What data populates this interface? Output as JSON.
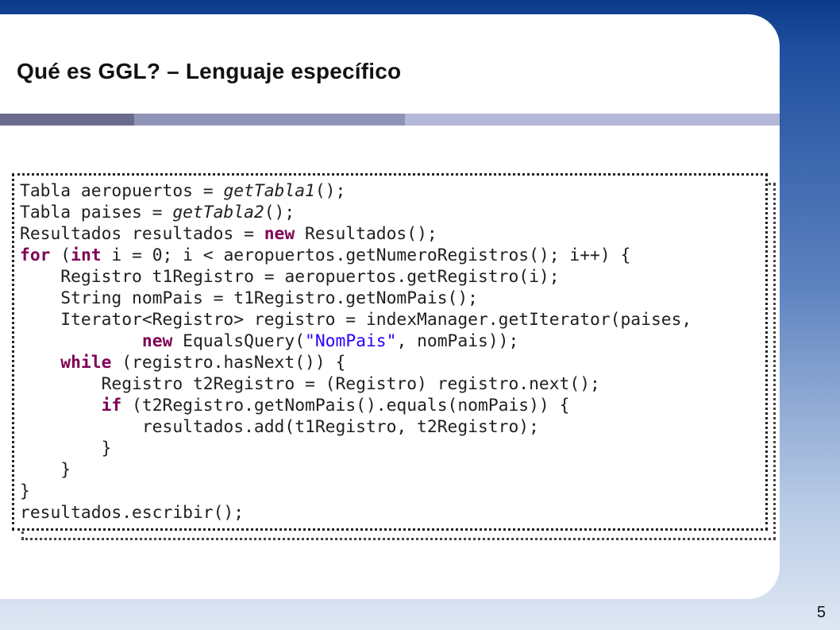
{
  "slide": {
    "title": "Qué es GGL? – Lenguaje específico",
    "page_number": "5"
  },
  "code": [
    [
      {
        "t": "Tabla aeropuertos = "
      },
      {
        "t": "getTabla1",
        "c": "it"
      },
      {
        "t": "();"
      }
    ],
    [
      {
        "t": "Tabla paises = "
      },
      {
        "t": "getTabla2",
        "c": "it"
      },
      {
        "t": "();"
      }
    ],
    [
      {
        "t": "Resultados resultados = "
      },
      {
        "t": "new",
        "c": "kw"
      },
      {
        "t": " Resultados();"
      }
    ],
    [
      {
        "t": "for",
        "c": "kw"
      },
      {
        "t": " ("
      },
      {
        "t": "int",
        "c": "kw"
      },
      {
        "t": " i = 0; i < aeropuertos.getNumeroRegistros(); i++) {"
      }
    ],
    [
      {
        "t": "    Registro t1Registro = aeropuertos.getRegistro(i);"
      }
    ],
    [
      {
        "t": "    String nomPais = t1Registro.getNomPais();"
      }
    ],
    [
      {
        "t": "    Iterator<Registro> registro = indexManager.getIterator(paises,"
      }
    ],
    [
      {
        "t": "            "
      },
      {
        "t": "new",
        "c": "kw"
      },
      {
        "t": " EqualsQuery("
      },
      {
        "t": "\"NomPais\"",
        "c": "str"
      },
      {
        "t": ", nomPais));"
      }
    ],
    [
      {
        "t": "    "
      },
      {
        "t": "while",
        "c": "kw"
      },
      {
        "t": " (registro.hasNext()) {"
      }
    ],
    [
      {
        "t": "        Registro t2Registro = (Registro) registro.next();"
      }
    ],
    [
      {
        "t": "        "
      },
      {
        "t": "if",
        "c": "kw"
      },
      {
        "t": " (t2Registro.getNomPais().equals(nomPais)) {"
      }
    ],
    [
      {
        "t": "            resultados.add(t1Registro, t2Registro);"
      }
    ],
    [
      {
        "t": "        }"
      }
    ],
    [
      {
        "t": "    }"
      }
    ],
    [
      {
        "t": "}"
      }
    ],
    [
      {
        "t": "resultados.escribir();"
      }
    ]
  ]
}
